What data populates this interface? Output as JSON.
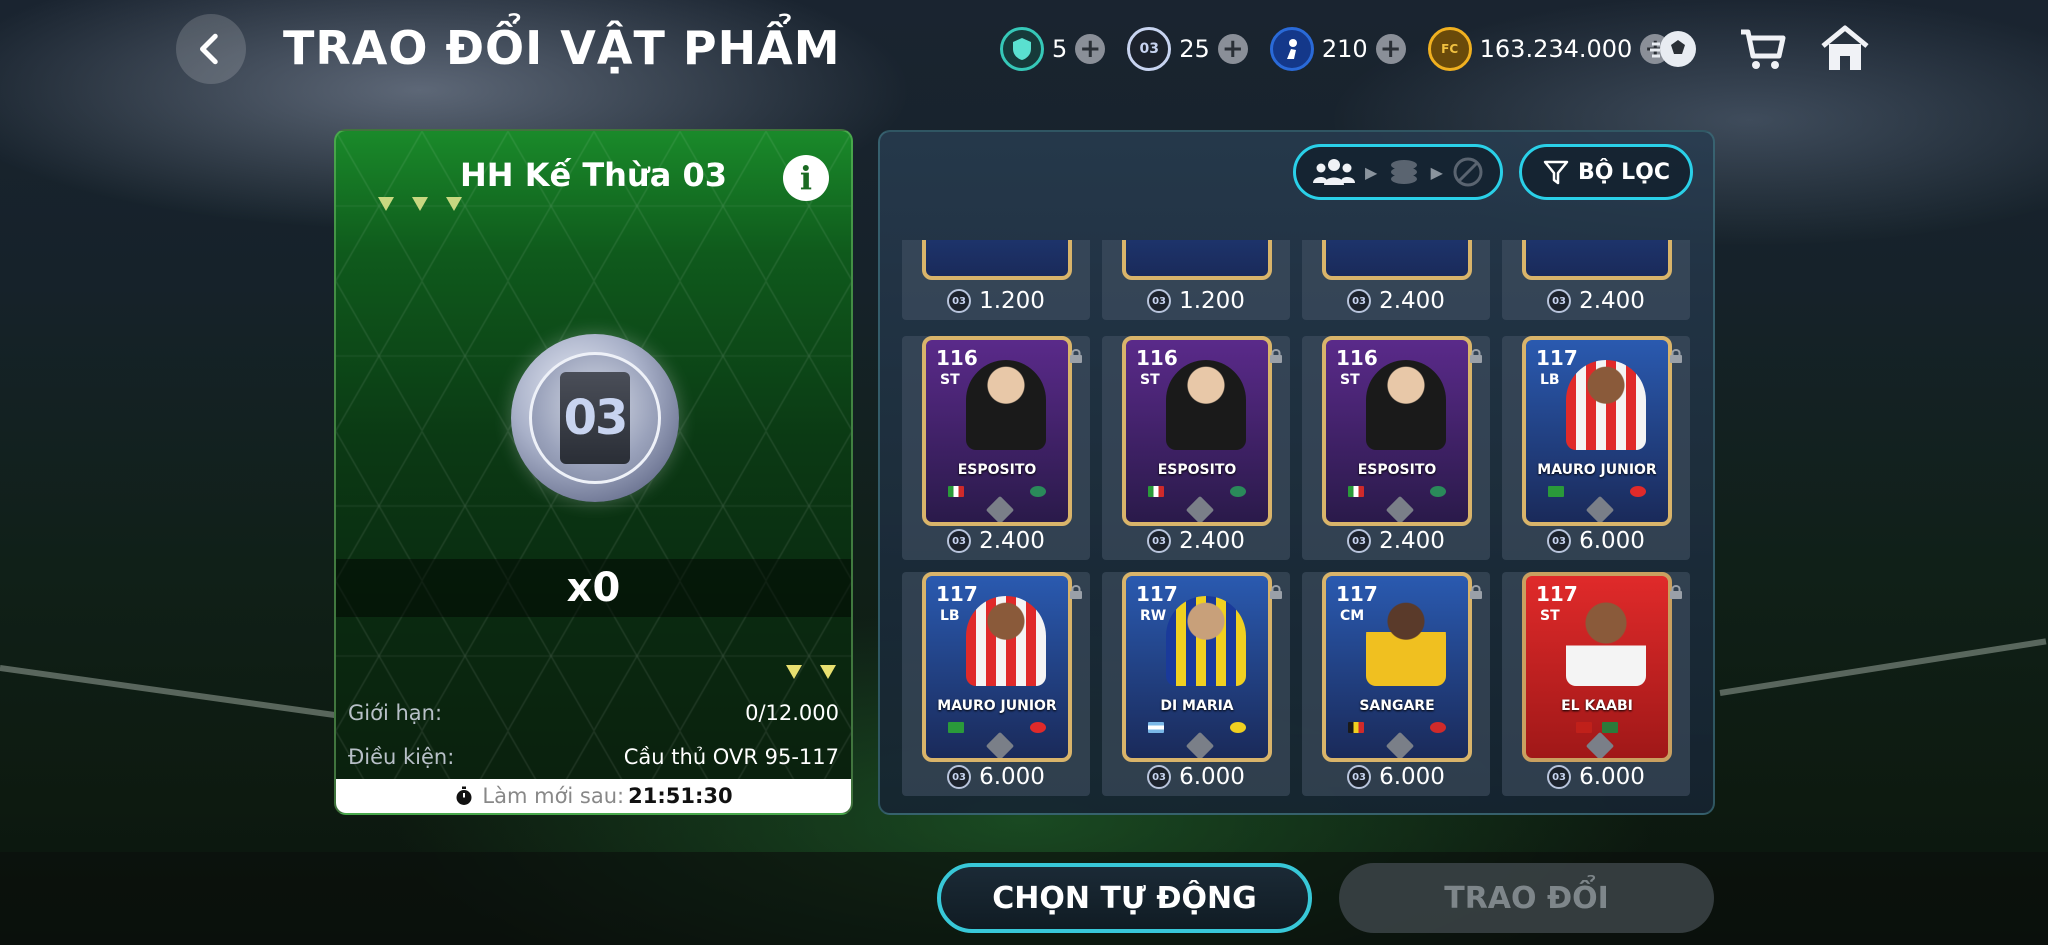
{
  "header": {
    "title": "TRAO ĐỔI VẬT PHẨM",
    "currencies": [
      {
        "icon": "shield-gem-icon",
        "value": "5",
        "color": "#36c8b8"
      },
      {
        "icon": "card-coin-icon",
        "label": "03",
        "value": "25",
        "color": "#c8d4f0"
      },
      {
        "icon": "player-token-icon",
        "value": "210",
        "color": "#2a6ad8"
      },
      {
        "icon": "fc-coin-icon",
        "value": "163.234.000",
        "color": "#f0b020"
      }
    ]
  },
  "left_panel": {
    "title": "HH Kế Thừa 03",
    "coin_label": "03",
    "count": "x0",
    "limit_label": "Giới hạn:",
    "limit_value": "0/12.000",
    "condition_label": "Điều kiện:",
    "condition_value": "Cầu thủ OVR 95-117",
    "refresh_label": "Làm mới sau:",
    "refresh_time": "21:51:30"
  },
  "right_panel": {
    "filter_label": "BỘ LỌC",
    "partial_row_prices": [
      "1.200",
      "1.200",
      "2.400",
      "2.400"
    ],
    "cards": [
      {
        "ovr": "116",
        "pos": "ST",
        "name": "ESPOSITO",
        "price": "2.400",
        "style": "purple"
      },
      {
        "ovr": "116",
        "pos": "ST",
        "name": "ESPOSITO",
        "price": "2.400",
        "style": "purple"
      },
      {
        "ovr": "116",
        "pos": "ST",
        "name": "ESPOSITO",
        "price": "2.400",
        "style": "purple"
      },
      {
        "ovr": "117",
        "pos": "LB",
        "name": "MAURO JUNIOR",
        "price": "6.000",
        "style": "blue"
      },
      {
        "ovr": "117",
        "pos": "LB",
        "name": "MAURO JUNIOR",
        "price": "6.000",
        "style": "blue"
      },
      {
        "ovr": "117",
        "pos": "RW",
        "name": "DI MARIA",
        "price": "6.000",
        "style": "blue"
      },
      {
        "ovr": "117",
        "pos": "CM",
        "name": "SANGARE",
        "price": "6.000",
        "style": "blue"
      },
      {
        "ovr": "117",
        "pos": "ST",
        "name": "EL KAABI",
        "price": "6.000",
        "style": "red"
      }
    ]
  },
  "footer": {
    "auto_select_label": "CHỌN TỰ ĐỘNG",
    "trade_label": "TRAO ĐỔI"
  }
}
